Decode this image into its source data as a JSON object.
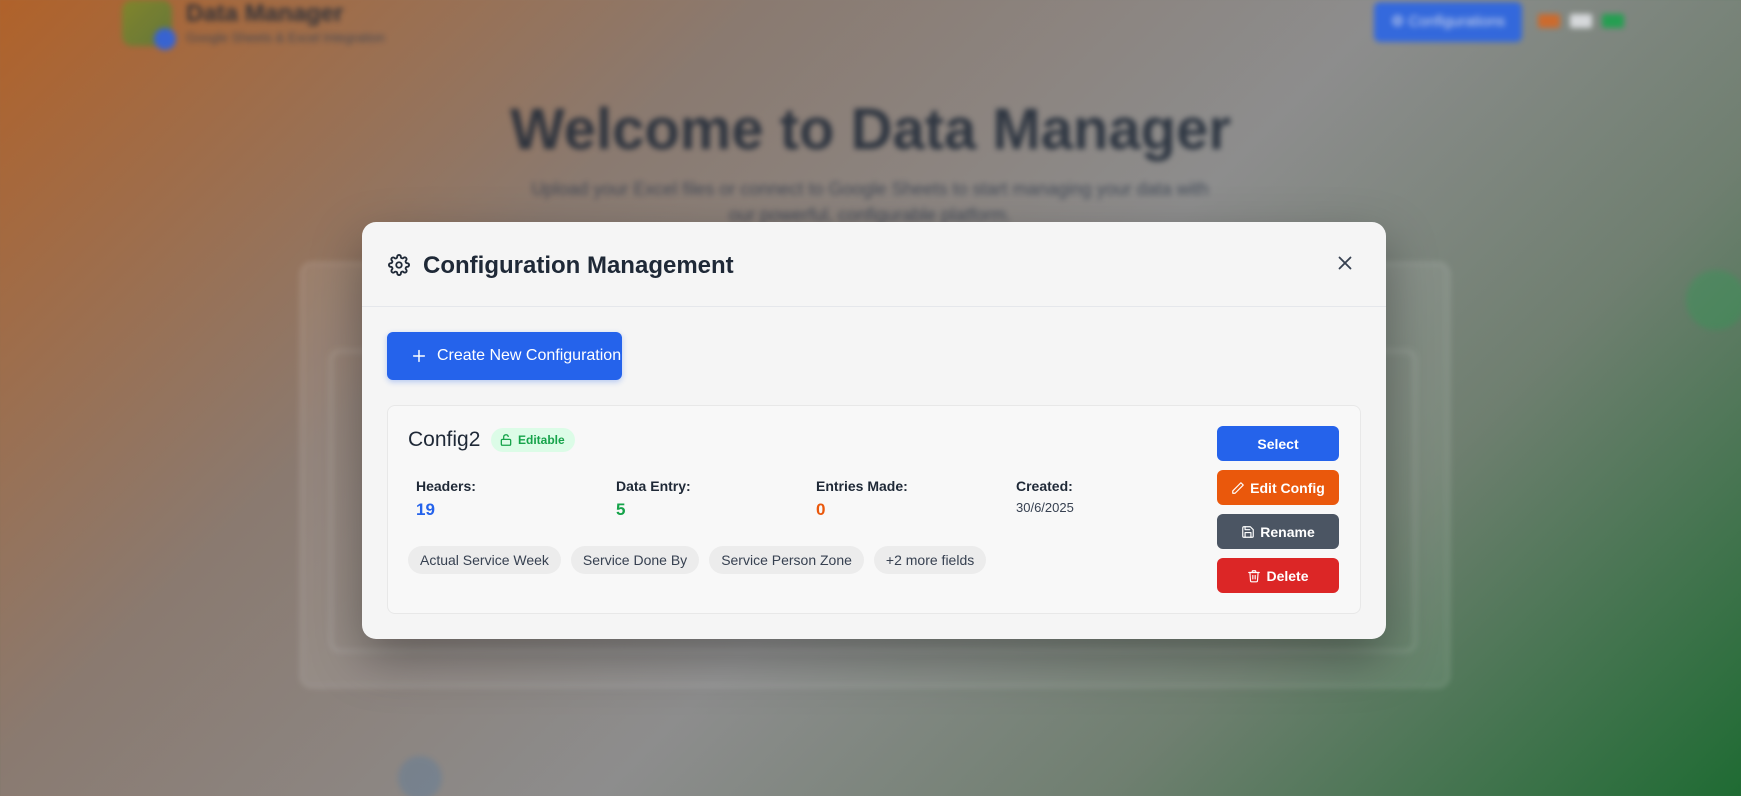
{
  "background": {
    "app_title": "Data Manager",
    "app_subtitle": "Google Sheets & Excel Integration",
    "config_button": "⚙ Configurations",
    "welcome_title": "Welcome to Data Manager",
    "welcome_subtitle": "Upload your Excel files or connect to Google Sheets to start managing your data with our powerful, configurable platform."
  },
  "modal": {
    "title": "Configuration Management",
    "create_button": "Create New Configuration",
    "configs": [
      {
        "name": "Config2",
        "badge": "Editable",
        "stats": [
          {
            "label": "Headers:",
            "value": "19",
            "color": "#2563eb"
          },
          {
            "label": "Data Entry:",
            "value": "5",
            "color": "#16a34a"
          },
          {
            "label": "Entries Made:",
            "value": "0",
            "color": "#ea580c"
          },
          {
            "label": "Created:",
            "value": "30/6/2025"
          }
        ],
        "tags": [
          "Actual Service Week",
          "Service Done By",
          "Service Person Zone",
          "+2 more fields"
        ],
        "actions": {
          "select": "Select",
          "edit": "Edit Config",
          "rename": "Rename",
          "delete": "Delete"
        }
      }
    ]
  },
  "colors": {
    "primary": "#2563eb",
    "success": "#16a34a",
    "warning": "#ea580c",
    "neutral": "#4b5563",
    "danger": "#dc2626"
  }
}
